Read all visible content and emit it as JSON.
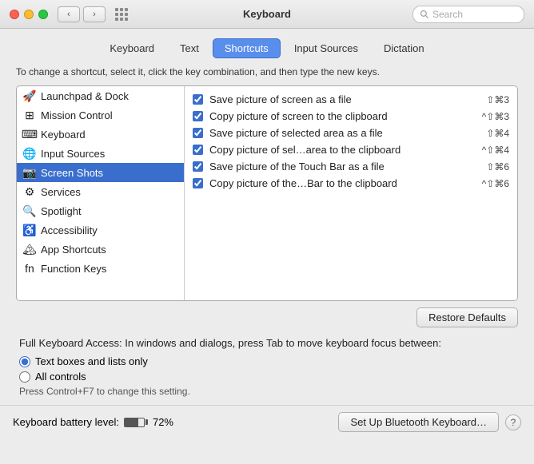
{
  "titlebar": {
    "title": "Keyboard",
    "search_placeholder": "Search"
  },
  "tabs": [
    {
      "id": "keyboard",
      "label": "Keyboard",
      "active": false
    },
    {
      "id": "text",
      "label": "Text",
      "active": false
    },
    {
      "id": "shortcuts",
      "label": "Shortcuts",
      "active": true
    },
    {
      "id": "input-sources",
      "label": "Input Sources",
      "active": false
    },
    {
      "id": "dictation",
      "label": "Dictation",
      "active": false
    }
  ],
  "instruction": "To change a shortcut, select it, click the key combination, and then type the new keys.",
  "sidebar": {
    "items": [
      {
        "id": "launchpad",
        "label": "Launchpad & Dock",
        "icon": "🚀",
        "selected": false
      },
      {
        "id": "mission-control",
        "label": "Mission Control",
        "icon": "⊞",
        "selected": false
      },
      {
        "id": "keyboard",
        "label": "Keyboard",
        "icon": "⌨",
        "selected": false
      },
      {
        "id": "input-sources",
        "label": "Input Sources",
        "icon": "🌐",
        "selected": false
      },
      {
        "id": "screen-shots",
        "label": "Screen Shots",
        "icon": "📷",
        "selected": true
      },
      {
        "id": "services",
        "label": "Services",
        "icon": "⚙",
        "selected": false
      },
      {
        "id": "spotlight",
        "label": "Spotlight",
        "icon": "🔍",
        "selected": false
      },
      {
        "id": "accessibility",
        "label": "Accessibility",
        "icon": "♿",
        "selected": false
      },
      {
        "id": "app-shortcuts",
        "label": "App Shortcuts",
        "icon": "🏔",
        "selected": false
      },
      {
        "id": "function-keys",
        "label": "Function Keys",
        "icon": "fn",
        "selected": false
      }
    ]
  },
  "shortcuts": [
    {
      "id": "save-screen-file",
      "label": "Save picture of screen as a file",
      "keys": "⇧⌘3",
      "checked": true
    },
    {
      "id": "copy-screen-clipboard",
      "label": "Copy picture of screen to the clipboard",
      "keys": "^⇧⌘3",
      "checked": true
    },
    {
      "id": "save-area-file",
      "label": "Save picture of selected area as a file",
      "keys": "⇧⌘4",
      "checked": true
    },
    {
      "id": "copy-area-clipboard",
      "label": "Copy picture of sel…area to the clipboard",
      "keys": "^⇧⌘4",
      "checked": true
    },
    {
      "id": "save-touchbar-file",
      "label": "Save picture of the Touch Bar as a file",
      "keys": "⇧⌘6",
      "checked": true
    },
    {
      "id": "copy-touchbar-clipboard",
      "label": "Copy picture of the…Bar to the clipboard",
      "keys": "^⇧⌘6",
      "checked": true
    }
  ],
  "buttons": {
    "restore_defaults": "Restore Defaults",
    "bluetooth": "Set Up Bluetooth Keyboard…",
    "help": "?"
  },
  "full_keyboard_access": {
    "title": "Full Keyboard Access: In windows and dialogs, press Tab to move keyboard focus between:",
    "options": [
      {
        "id": "text-boxes",
        "label": "Text boxes and lists only",
        "selected": true
      },
      {
        "id": "all-controls",
        "label": "All controls",
        "selected": false
      }
    ],
    "hint": "Press Control+F7 to change this setting."
  },
  "footer": {
    "battery_label": "Keyboard battery level:",
    "battery_percent": "72%"
  }
}
